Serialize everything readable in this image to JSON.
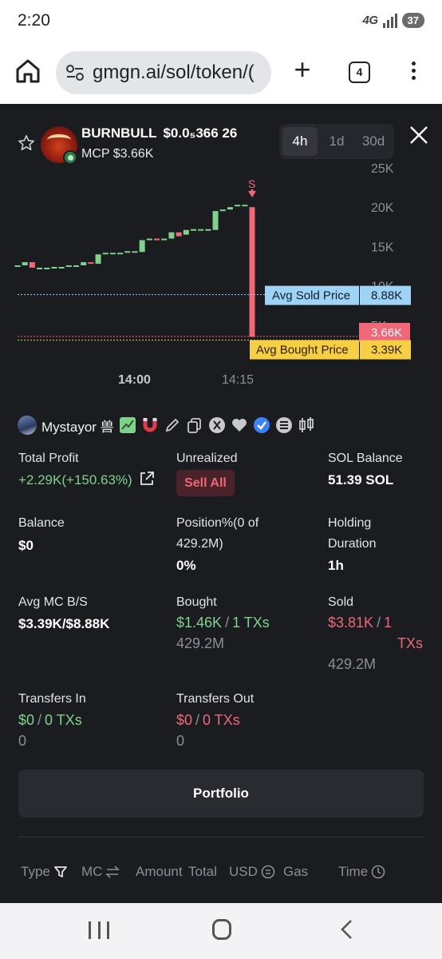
{
  "status_bar": {
    "time": "2:20",
    "network": "4G",
    "battery": "37"
  },
  "browser": {
    "url": "gmgn.ai/sol/token/(",
    "tab_count": "4"
  },
  "token": {
    "name": "BURNBULL",
    "price": "$0.0₅366 26",
    "mcp": "MCP $3.66K"
  },
  "timeframes": [
    "4h",
    "1d",
    "30d"
  ],
  "active_timeframe": "4h",
  "chart_data": {
    "type": "candlestick",
    "y_ticks": [
      "25K",
      "20K",
      "15K",
      "10K",
      "5K"
    ],
    "ylim": [
      0,
      25000
    ],
    "x_ticks": [
      "14:00",
      "14:15"
    ],
    "candles": [
      {
        "open": 12600,
        "close": 12600
      },
      {
        "open": 12600,
        "close": 13000
      },
      {
        "open": 13000,
        "close": 12300
      },
      {
        "open": 12300,
        "close": 12300
      },
      {
        "open": 12300,
        "close": 12300
      },
      {
        "open": 12400,
        "close": 12400
      },
      {
        "open": 12400,
        "close": 12400
      },
      {
        "open": 12400,
        "close": 12600
      },
      {
        "open": 12600,
        "close": 12600
      },
      {
        "open": 12600,
        "close": 13000
      },
      {
        "open": 13000,
        "close": 12800
      },
      {
        "open": 12800,
        "close": 14000
      },
      {
        "open": 14000,
        "close": 14200
      },
      {
        "open": 14200,
        "close": 14200
      },
      {
        "open": 14200,
        "close": 14200
      },
      {
        "open": 14200,
        "close": 14400
      },
      {
        "open": 14400,
        "close": 14400
      },
      {
        "open": 14300,
        "close": 15800
      },
      {
        "open": 15800,
        "close": 16000
      },
      {
        "open": 16000,
        "close": 15800
      },
      {
        "open": 15800,
        "close": 16000
      },
      {
        "open": 16000,
        "close": 16800
      },
      {
        "open": 16800,
        "close": 16300
      },
      {
        "open": 16500,
        "close": 17100
      },
      {
        "open": 17100,
        "close": 17200
      },
      {
        "open": 17200,
        "close": 17200
      },
      {
        "open": 17200,
        "close": 17200
      },
      {
        "open": 17100,
        "close": 19500
      },
      {
        "open": 19500,
        "close": 19700
      },
      {
        "open": 19700,
        "close": 20000
      },
      {
        "open": 20100,
        "close": 20300
      },
      {
        "open": 20300,
        "close": 20300
      },
      {
        "open": 20000,
        "close": 3500
      }
    ],
    "sell_marker": "S",
    "avg_sold": {
      "label": "Avg Sold Price",
      "value": "8.88K",
      "y": 8880
    },
    "current": {
      "value": "3.66K",
      "y": 3660
    },
    "avg_bought": {
      "label": "Avg Bought Price",
      "value": "3.39K",
      "y": 3390
    }
  },
  "user": {
    "name": "Mystayor",
    "suffix": "兽"
  },
  "stats": {
    "total_profit_label": "Total Profit",
    "total_profit_value": "+2.29K(+150.63%)",
    "unrealized_label": "Unrealized",
    "sell_all": "Sell All",
    "sol_balance_label": "SOL Balance",
    "sol_balance_value": "51.39 SOL",
    "balance_label": "Balance",
    "balance_value": "$0",
    "position_label_1": "Position%(0 of",
    "position_label_2": "429.2M)",
    "position_value": "0%",
    "holding_label_1": "Holding",
    "holding_label_2": "Duration",
    "holding_value": "1h",
    "avg_mc_label": "Avg MC B/S",
    "avg_mc_value": "$3.39K/$8.88K",
    "bought_label": "Bought",
    "bought_usd": "$1.46K",
    "bought_txs": "1 TXs",
    "bought_amount": "429.2M",
    "sold_label": "Sold",
    "sold_usd": "$3.81K",
    "sold_txs_1": "1",
    "sold_txs_2": "TXs",
    "sold_amount": "429.2M",
    "transfers_in_label": "Transfers In",
    "transfers_in_usd": "$0",
    "transfers_in_txs": "0 TXs",
    "transfers_in_amount": "0",
    "transfers_out_label": "Transfers Out",
    "transfers_out_usd": "$0",
    "transfers_out_txs": "0 TXs",
    "transfers_out_amount": "0",
    "separator": "/"
  },
  "portfolio_button": "Portfolio",
  "table_headers": {
    "type": "Type",
    "mc": "MC",
    "amount": "Amount",
    "total": "Total",
    "usd": "USD",
    "gas": "Gas",
    "time": "Time"
  },
  "colors": {
    "green": "#7fd28c",
    "red": "#f06778",
    "sold_bg": "#9fd3f6",
    "bought_bg": "#f7cf45"
  }
}
